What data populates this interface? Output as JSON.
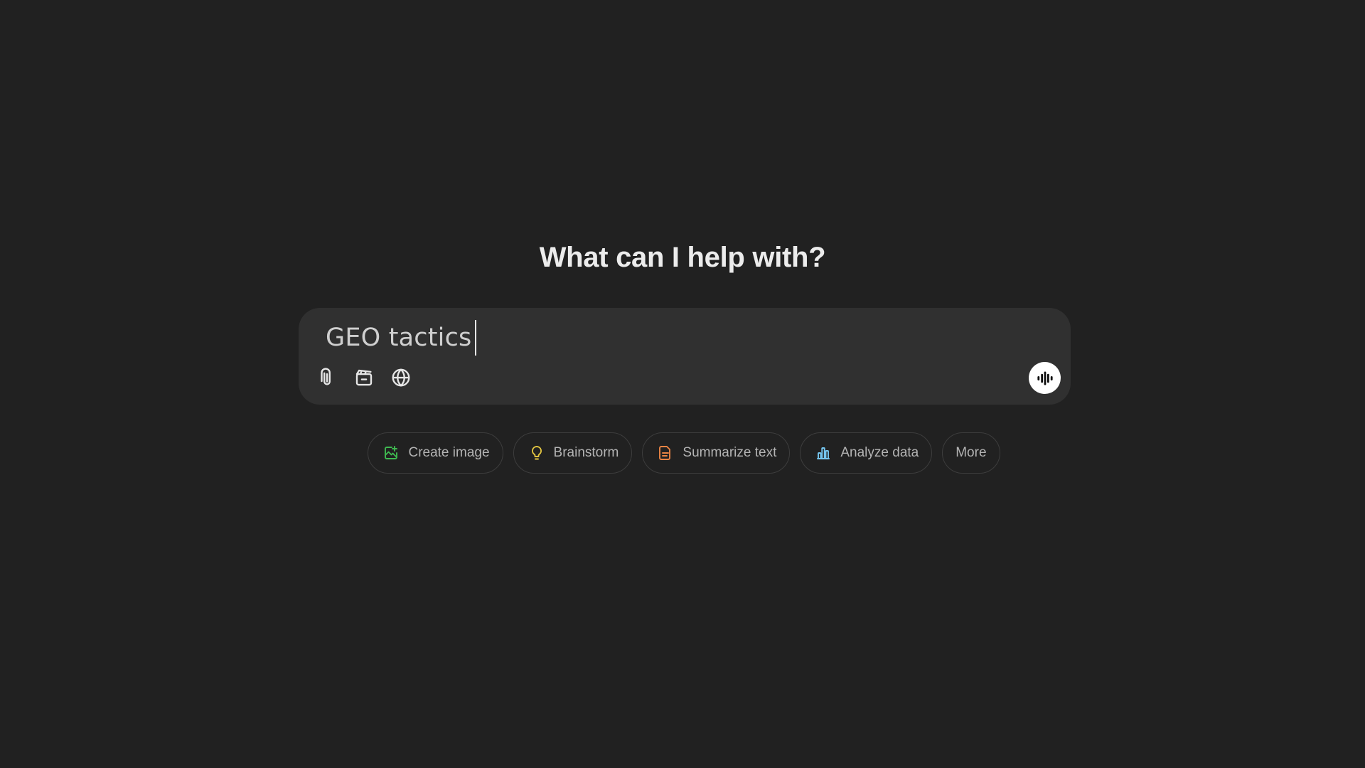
{
  "heading": "What can I help with?",
  "composer": {
    "input_value": "GEO tactics",
    "tools": [
      {
        "icon": "paperclip-icon"
      },
      {
        "icon": "toolbox-icon"
      },
      {
        "icon": "globe-icon"
      }
    ],
    "voice_icon": "voice-waveform-icon"
  },
  "chips": {
    "create_image": {
      "label": "Create image",
      "icon": "image-icon",
      "color": "#3fb950"
    },
    "brainstorm": {
      "label": "Brainstorm",
      "icon": "lightbulb-icon",
      "color": "#e2c541"
    },
    "summarize_text": {
      "label": "Summarize text",
      "icon": "document-icon",
      "color": "#ea8444"
    },
    "analyze_data": {
      "label": "Analyze data",
      "icon": "bar-chart-icon",
      "color": "#76c7f0"
    },
    "more": {
      "label": "More"
    }
  },
  "colors": {
    "background": "#212121",
    "composer": "#303030",
    "chip_border": "#3d3d3d"
  }
}
